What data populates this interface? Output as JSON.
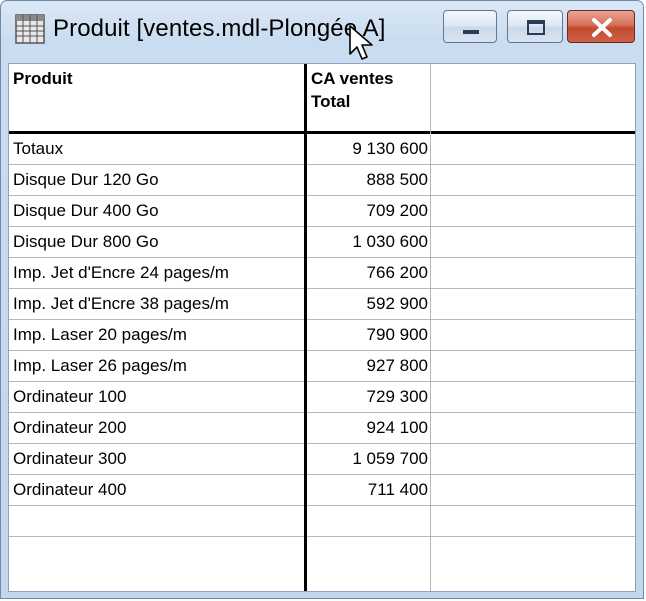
{
  "window": {
    "title": "Produit [ventes.mdl-Plongée A]",
    "controls": {
      "minimize": "minimize",
      "maximize": "maximize",
      "close": "close"
    }
  },
  "colors": {
    "frame": "#c9dcf0",
    "close_button": "#c94f33",
    "grid_line": "#b7b7b7",
    "header_rule": "#000000"
  },
  "table": {
    "headers": {
      "product": "Produit",
      "sales": "CA ventes Total"
    },
    "rows": [
      {
        "product": "Totaux",
        "sales": "9 130 600"
      },
      {
        "product": "Disque Dur 120 Go",
        "sales": "888 500"
      },
      {
        "product": "Disque Dur 400 Go",
        "sales": "709 200"
      },
      {
        "product": "Disque Dur 800 Go",
        "sales": "1 030 600"
      },
      {
        "product": "Imp. Jet d'Encre 24 pages/m",
        "sales": "766 200"
      },
      {
        "product": "Imp. Jet d'Encre 38 pages/m",
        "sales": "592 900"
      },
      {
        "product": "Imp. Laser 20 pages/m",
        "sales": "790 900"
      },
      {
        "product": "Imp. Laser 26 pages/m",
        "sales": "927 800"
      },
      {
        "product": "Ordinateur 100",
        "sales": "729 300"
      },
      {
        "product": "Ordinateur 200",
        "sales": "924 100"
      },
      {
        "product": "Ordinateur 300",
        "sales": "1 059 700"
      },
      {
        "product": "Ordinateur 400",
        "sales": "711 400"
      },
      {
        "product": "",
        "sales": ""
      }
    ]
  }
}
